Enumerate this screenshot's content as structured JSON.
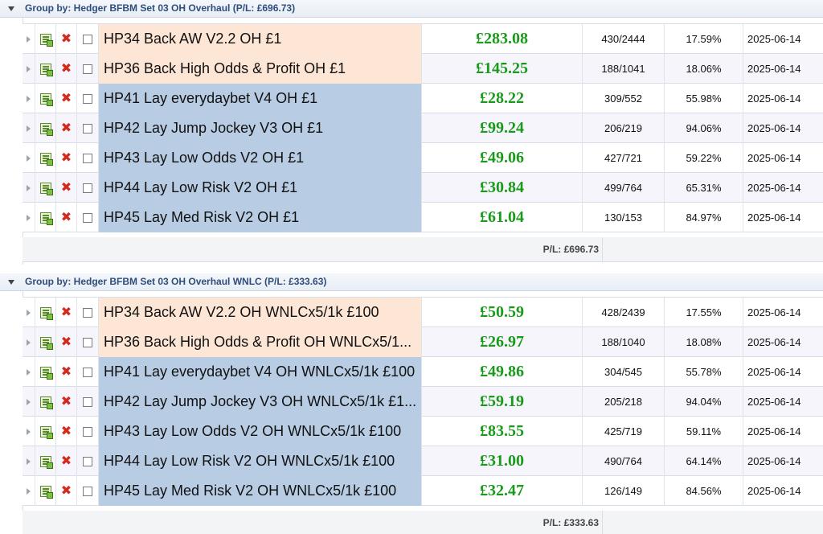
{
  "groups": [
    {
      "title": "Group by: Hedger BFBM Set 03 OH Overhaul (P/L: £696.73)",
      "summary": "P/L: £696.73",
      "rows": [
        {
          "name": "HP34 Back AW V2.2 OH £1",
          "kind": "back",
          "pl": "£283.08",
          "ratio": "430/2444",
          "pct": "17.59%",
          "date": "2025-06-14"
        },
        {
          "name": "HP36 Back High Odds & Profit OH £1",
          "kind": "back",
          "pl": "£145.25",
          "ratio": "188/1041",
          "pct": "18.06%",
          "date": "2025-06-14"
        },
        {
          "name": "HP41 Lay everydaybet V4 OH £1",
          "kind": "lay",
          "pl": "£28.22",
          "ratio": "309/552",
          "pct": "55.98%",
          "date": "2025-06-14"
        },
        {
          "name": "HP42 Lay Jump Jockey V3 OH £1",
          "kind": "lay",
          "pl": "£99.24",
          "ratio": "206/219",
          "pct": "94.06%",
          "date": "2025-06-14"
        },
        {
          "name": "HP43 Lay Low Odds V2 OH £1",
          "kind": "lay",
          "pl": "£49.06",
          "ratio": "427/721",
          "pct": "59.22%",
          "date": "2025-06-14"
        },
        {
          "name": "HP44 Lay Low Risk V2 OH £1",
          "kind": "lay",
          "pl": "£30.84",
          "ratio": "499/764",
          "pct": "65.31%",
          "date": "2025-06-14"
        },
        {
          "name": "HP45 Lay Med Risk V2 OH £1",
          "kind": "lay",
          "pl": "£61.04",
          "ratio": "130/153",
          "pct": "84.97%",
          "date": "2025-06-14"
        }
      ]
    },
    {
      "title": "Group by: Hedger BFBM Set 03 OH Overhaul WNLC (P/L: £333.63)",
      "summary": "P/L: £333.63",
      "rows": [
        {
          "name": "HP34 Back AW V2.2 OH WNLCx5/1k £100",
          "kind": "back",
          "pl": "£50.59",
          "ratio": "428/2439",
          "pct": "17.55%",
          "date": "2025-06-14"
        },
        {
          "name": "HP36 Back High Odds & Profit OH WNLCx5/1...",
          "kind": "back",
          "pl": "£26.97",
          "ratio": "188/1040",
          "pct": "18.08%",
          "date": "2025-06-14"
        },
        {
          "name": "HP41 Lay everydaybet V4 OH WNLCx5/1k £100",
          "kind": "lay",
          "pl": "£49.86",
          "ratio": "304/545",
          "pct": "55.78%",
          "date": "2025-06-14"
        },
        {
          "name": "HP42 Lay Jump Jockey V3 OH WNLCx5/1k £1...",
          "kind": "lay",
          "pl": "£59.19",
          "ratio": "205/218",
          "pct": "94.04%",
          "date": "2025-06-14"
        },
        {
          "name": "HP43 Lay Low Odds V2 OH WNLCx5/1k £100",
          "kind": "lay",
          "pl": "£83.55",
          "ratio": "425/719",
          "pct": "59.11%",
          "date": "2025-06-14"
        },
        {
          "name": "HP44 Lay Low Risk V2 OH WNLCx5/1k £100",
          "kind": "lay",
          "pl": "£31.00",
          "ratio": "490/764",
          "pct": "64.14%",
          "date": "2025-06-14"
        },
        {
          "name": "HP45 Lay Med Risk V2 OH WNLCx5/1k £100",
          "kind": "lay",
          "pl": "£32.47",
          "ratio": "126/149",
          "pct": "84.56%",
          "date": "2025-06-14"
        }
      ]
    }
  ],
  "icons": {
    "expand": "expand-arrow-icon",
    "edit": "edit-icon",
    "delete": "delete-x-icon",
    "select": "checkbox"
  },
  "colors": {
    "back_row": "#fde6d6",
    "lay_row": "#b8cce4",
    "profit_green": "#1a9a1a",
    "group_title": "#2e4d7a"
  }
}
